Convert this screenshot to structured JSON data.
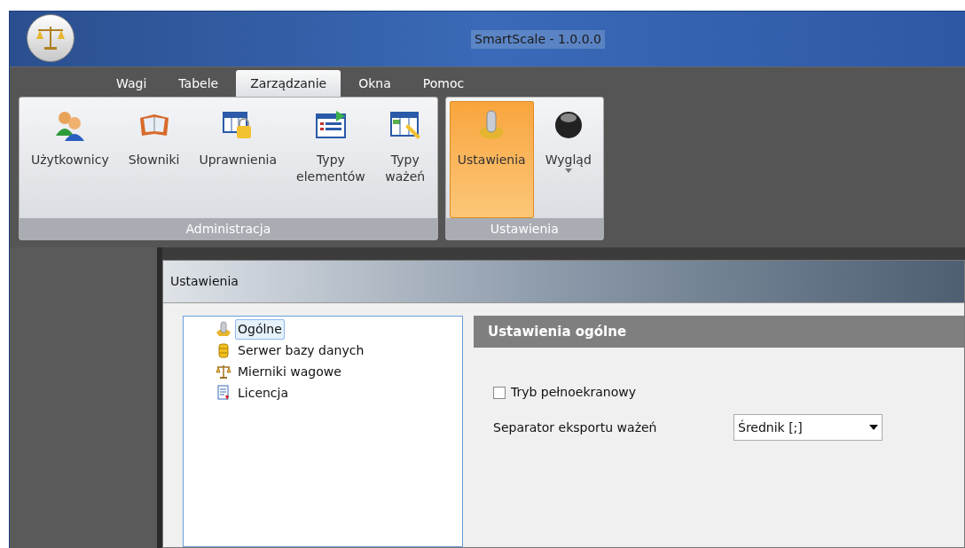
{
  "window": {
    "title": "SmartScale - 1.0.0.0"
  },
  "tabs": [
    {
      "label": "Wagi",
      "selected": false
    },
    {
      "label": "Tabele",
      "selected": false
    },
    {
      "label": "Zarządzanie",
      "selected": true
    },
    {
      "label": "Okna",
      "selected": false
    },
    {
      "label": "Pomoc",
      "selected": false
    }
  ],
  "ribbon_groups": [
    {
      "label": "Administracja",
      "items": [
        {
          "kind": "users",
          "label": "Użytkownicy",
          "selected": false,
          "dropdown": false
        },
        {
          "kind": "book",
          "label": "Słowniki",
          "selected": false,
          "dropdown": false
        },
        {
          "kind": "lock-table",
          "label": "Uprawnienia",
          "selected": false,
          "dropdown": false
        },
        {
          "kind": "list",
          "label": "Typy elementów",
          "selected": false,
          "dropdown": false
        },
        {
          "kind": "edit-table",
          "label": "Typy ważeń",
          "selected": false,
          "dropdown": false
        }
      ]
    },
    {
      "label": "Ustawienia",
      "items": [
        {
          "kind": "gear",
          "label": "Ustawienia",
          "selected": true,
          "dropdown": false
        },
        {
          "kind": "ball",
          "label": "Wygląd",
          "selected": false,
          "dropdown": true
        }
      ]
    }
  ],
  "dialog": {
    "title": "Ustawienia",
    "tree": [
      {
        "kind": "gear",
        "label": "Ogólne",
        "selected": true
      },
      {
        "kind": "database",
        "label": "Serwer bazy danych",
        "selected": false
      },
      {
        "kind": "scale",
        "label": "Mierniki wagowe",
        "selected": false
      },
      {
        "kind": "license",
        "label": "Licencja",
        "selected": false
      }
    ],
    "section_title": "Ustawienia ogólne",
    "fullscreen": {
      "label": "Tryb pełnoekranowy",
      "checked": false
    },
    "separator": {
      "label": "Separator eksportu ważeń",
      "value": "Średnik [;]"
    }
  }
}
